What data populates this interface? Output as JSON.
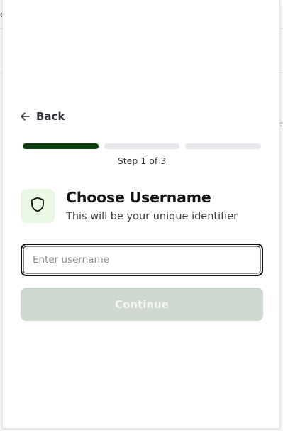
{
  "background": {
    "fragment_left": "e",
    "fragment_right": "c"
  },
  "back": {
    "label": "Back",
    "icon": "arrow-left-icon"
  },
  "progress": {
    "total_steps": 3,
    "current_step": 1,
    "step_label": "Step 1 of 3",
    "colors": {
      "active": "#0b3d0e",
      "inactive": "#e8e8ec"
    }
  },
  "header": {
    "icon": "shield-icon",
    "title": "Choose Username",
    "subtitle": "This will be your unique identifier"
  },
  "username_input": {
    "value": "",
    "placeholder": "Enter username"
  },
  "continue_button": {
    "label": "Continue",
    "disabled": true,
    "color": "#cfd8cf"
  }
}
